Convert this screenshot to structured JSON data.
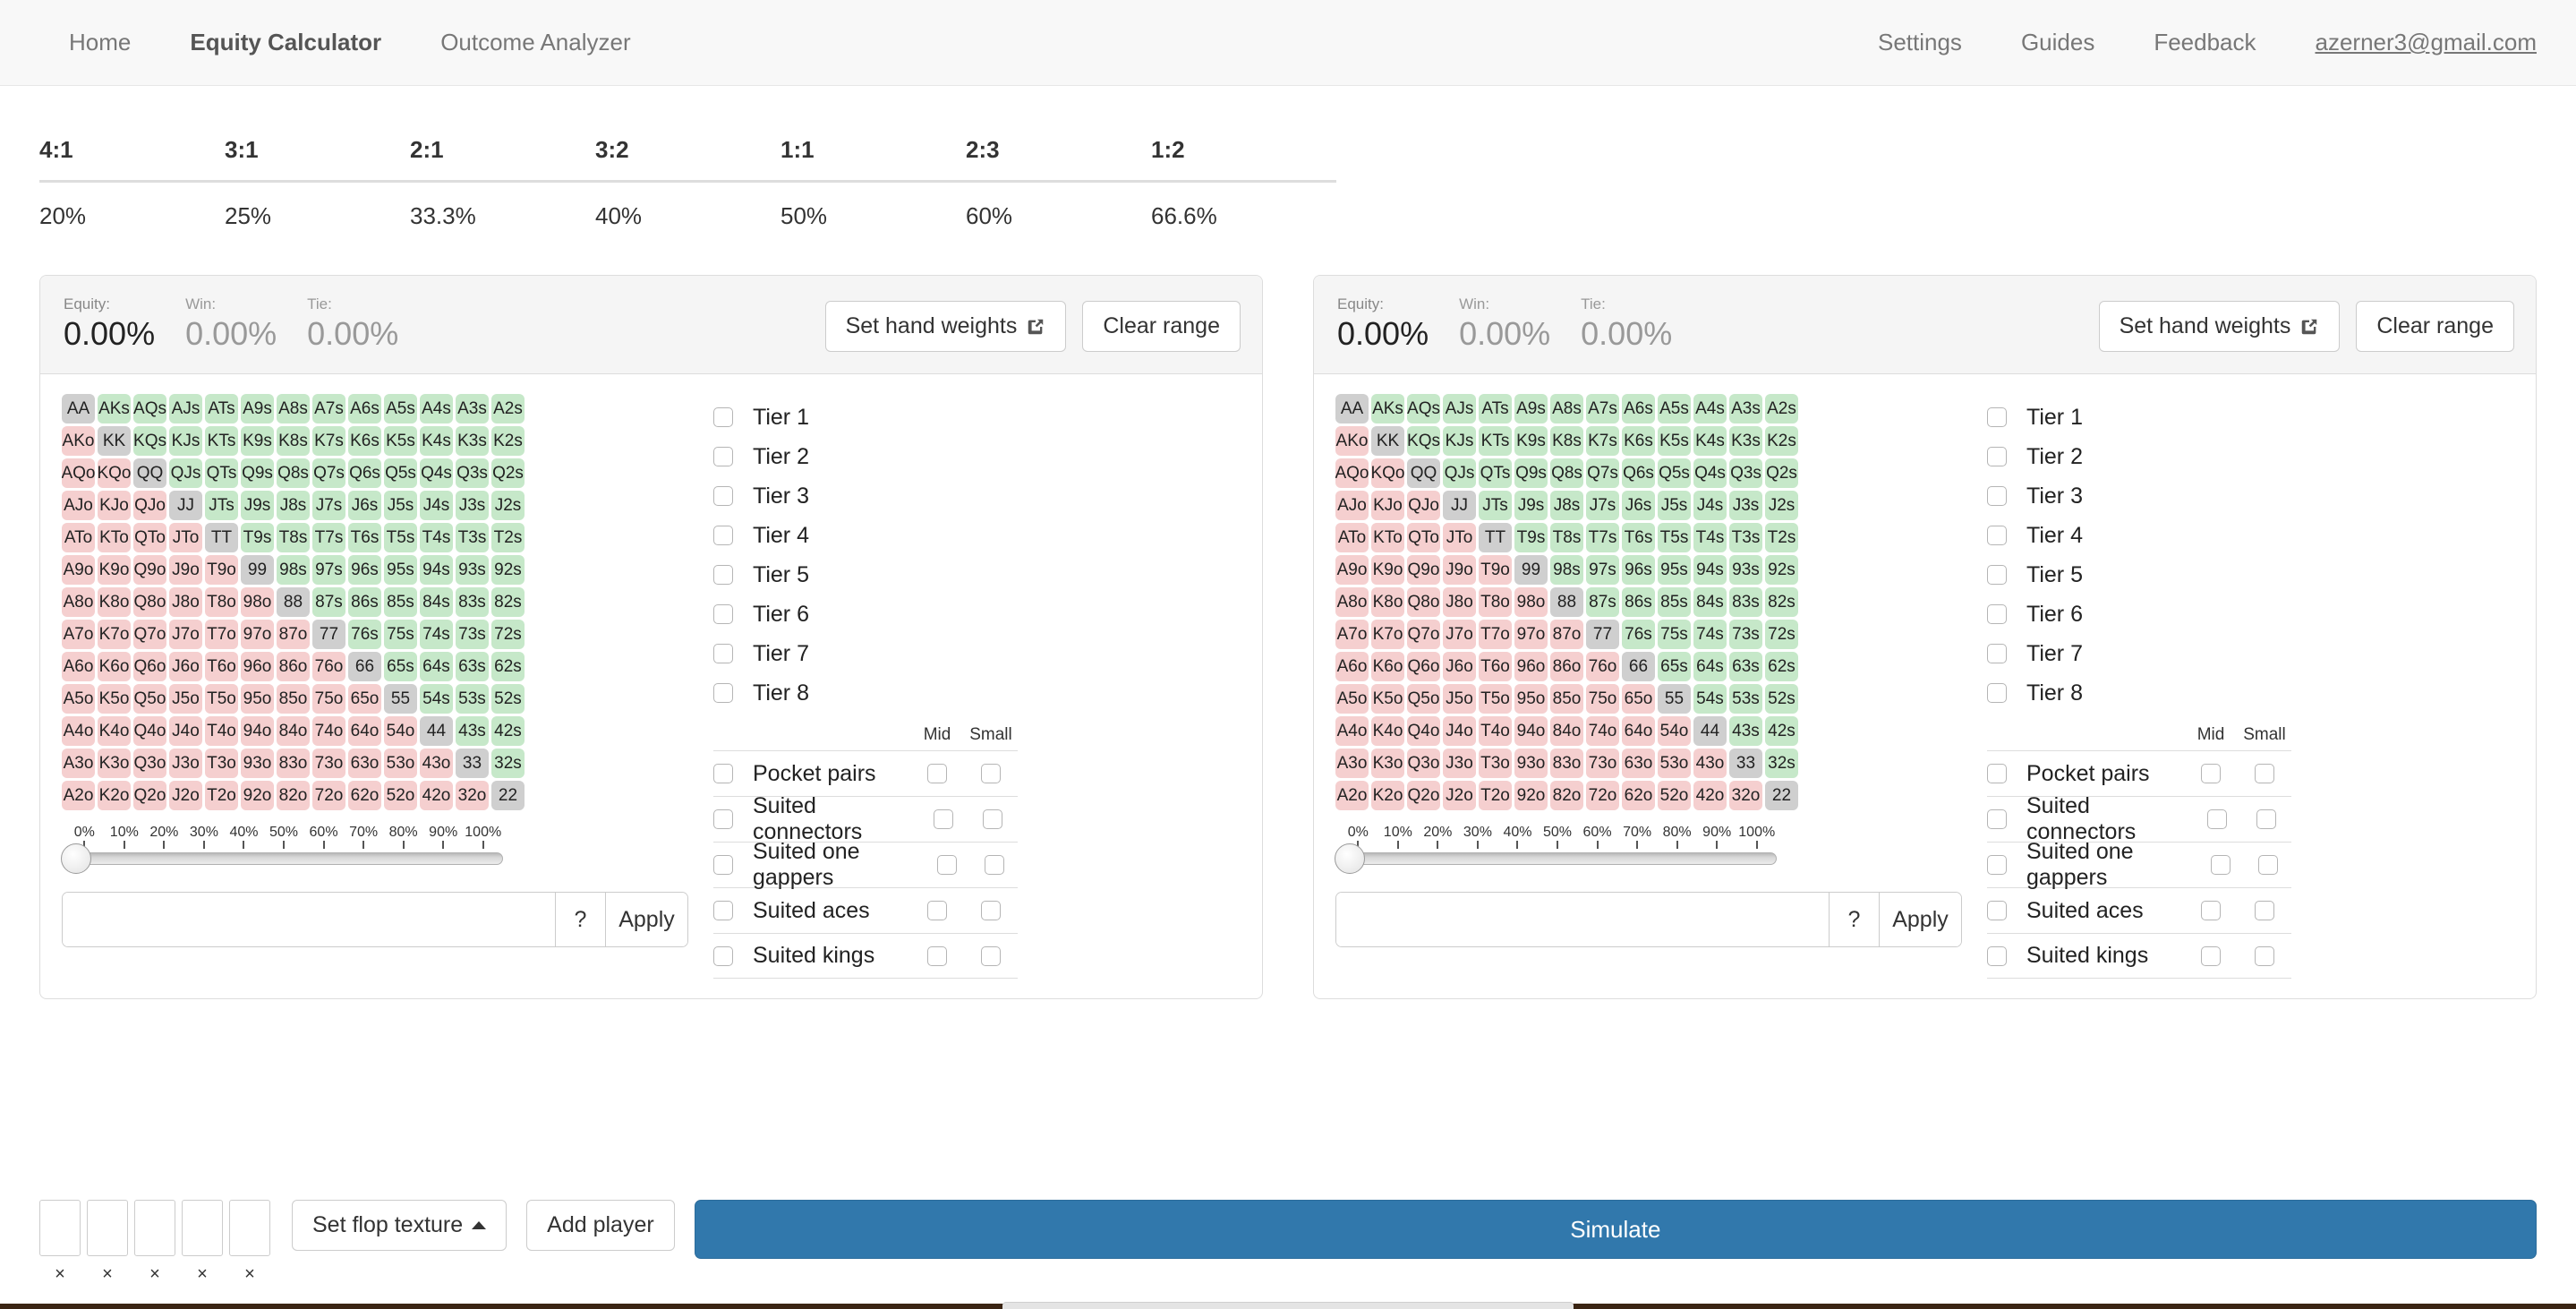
{
  "nav": {
    "left_items": [
      {
        "label": "Home",
        "active": false
      },
      {
        "label": "Equity Calculator",
        "active": true
      },
      {
        "label": "Outcome Analyzer",
        "active": false
      }
    ],
    "right_items": [
      {
        "label": "Settings"
      },
      {
        "label": "Guides"
      },
      {
        "label": "Feedback"
      }
    ],
    "account": "azerner3@gmail.com"
  },
  "odds": {
    "ratios": [
      "4:1",
      "3:1",
      "2:1",
      "3:2",
      "1:1",
      "2:3",
      "1:2"
    ],
    "percents": [
      "20%",
      "25%",
      "33.3%",
      "40%",
      "50%",
      "60%",
      "66.6%"
    ]
  },
  "panel": {
    "equity_label": "Equity:",
    "equity_value": "0.00%",
    "win_label": "Win:",
    "win_value": "0.00%",
    "tie_label": "Tie:",
    "tie_value": "0.00%",
    "set_hand_weights": "Set hand weights",
    "clear_range": "Clear range",
    "tiers": [
      "Tier 1",
      "Tier 2",
      "Tier 3",
      "Tier 4",
      "Tier 5",
      "Tier 6",
      "Tier 7",
      "Tier 8"
    ],
    "cat_col_mid": "Mid",
    "cat_col_small": "Small",
    "categories": [
      "Pocket pairs",
      "Suited connectors",
      "Suited one gappers",
      "Suited aces",
      "Suited kings"
    ],
    "slider_ticks": [
      "0%",
      "10%",
      "20%",
      "30%",
      "40%",
      "50%",
      "60%",
      "70%",
      "80%",
      "90%",
      "100%"
    ],
    "slider_value": "0%",
    "range_input_value": "",
    "range_input_placeholder": "",
    "help_label": "?",
    "apply_label": "Apply"
  },
  "matrix": {
    "ranks": [
      "A",
      "K",
      "Q",
      "J",
      "T",
      "9",
      "8",
      "7",
      "6",
      "5",
      "4",
      "3",
      "2"
    ],
    "rows": [
      [
        "AA",
        "AKs",
        "AQs",
        "AJs",
        "ATs",
        "A9s",
        "A8s",
        "A7s",
        "A6s",
        "A5s",
        "A4s",
        "A3s",
        "A2s"
      ],
      [
        "AKo",
        "KK",
        "KQs",
        "KJs",
        "KTs",
        "K9s",
        "K8s",
        "K7s",
        "K6s",
        "K5s",
        "K4s",
        "K3s",
        "K2s"
      ],
      [
        "AQo",
        "KQo",
        "QQ",
        "QJs",
        "QTs",
        "Q9s",
        "Q8s",
        "Q7s",
        "Q6s",
        "Q5s",
        "Q4s",
        "Q3s",
        "Q2s"
      ],
      [
        "AJo",
        "KJo",
        "QJo",
        "JJ",
        "JTs",
        "J9s",
        "J8s",
        "J7s",
        "J6s",
        "J5s",
        "J4s",
        "J3s",
        "J2s"
      ],
      [
        "ATo",
        "KTo",
        "QTo",
        "JTo",
        "TT",
        "T9s",
        "T8s",
        "T7s",
        "T6s",
        "T5s",
        "T4s",
        "T3s",
        "T2s"
      ],
      [
        "A9o",
        "K9o",
        "Q9o",
        "J9o",
        "T9o",
        "99",
        "98s",
        "97s",
        "96s",
        "95s",
        "94s",
        "93s",
        "92s"
      ],
      [
        "A8o",
        "K8o",
        "Q8o",
        "J8o",
        "T8o",
        "98o",
        "88",
        "87s",
        "86s",
        "85s",
        "84s",
        "83s",
        "82s"
      ],
      [
        "A7o",
        "K7o",
        "Q7o",
        "J7o",
        "T7o",
        "97o",
        "87o",
        "77",
        "76s",
        "75s",
        "74s",
        "73s",
        "72s"
      ],
      [
        "A6o",
        "K6o",
        "Q6o",
        "J6o",
        "T6o",
        "96o",
        "86o",
        "76o",
        "66",
        "65s",
        "64s",
        "63s",
        "62s"
      ],
      [
        "A5o",
        "K5o",
        "Q5o",
        "J5o",
        "T5o",
        "95o",
        "85o",
        "75o",
        "65o",
        "55",
        "54s",
        "53s",
        "52s"
      ],
      [
        "A4o",
        "K4o",
        "Q4o",
        "J4o",
        "T4o",
        "94o",
        "84o",
        "74o",
        "64o",
        "54o",
        "44",
        "43s",
        "42s"
      ],
      [
        "A3o",
        "K3o",
        "Q3o",
        "J3o",
        "T3o",
        "93o",
        "83o",
        "73o",
        "63o",
        "53o",
        "43o",
        "33",
        "32s"
      ],
      [
        "A2o",
        "K2o",
        "Q2o",
        "J2o",
        "T2o",
        "92o",
        "82o",
        "72o",
        "62o",
        "52o",
        "42o",
        "32o",
        "22"
      ]
    ]
  },
  "bottom": {
    "card_slot_count": 5,
    "card_remove_label": "×",
    "set_flop_texture": "Set flop texture",
    "add_player": "Add player",
    "simulate": "Simulate"
  },
  "colors": {
    "pair": "#cfcfcf",
    "suited": "#c6e8c9",
    "offsuit": "#f5cfcf",
    "accent": "#3178ac",
    "nav_bg": "#f8f8f8"
  }
}
